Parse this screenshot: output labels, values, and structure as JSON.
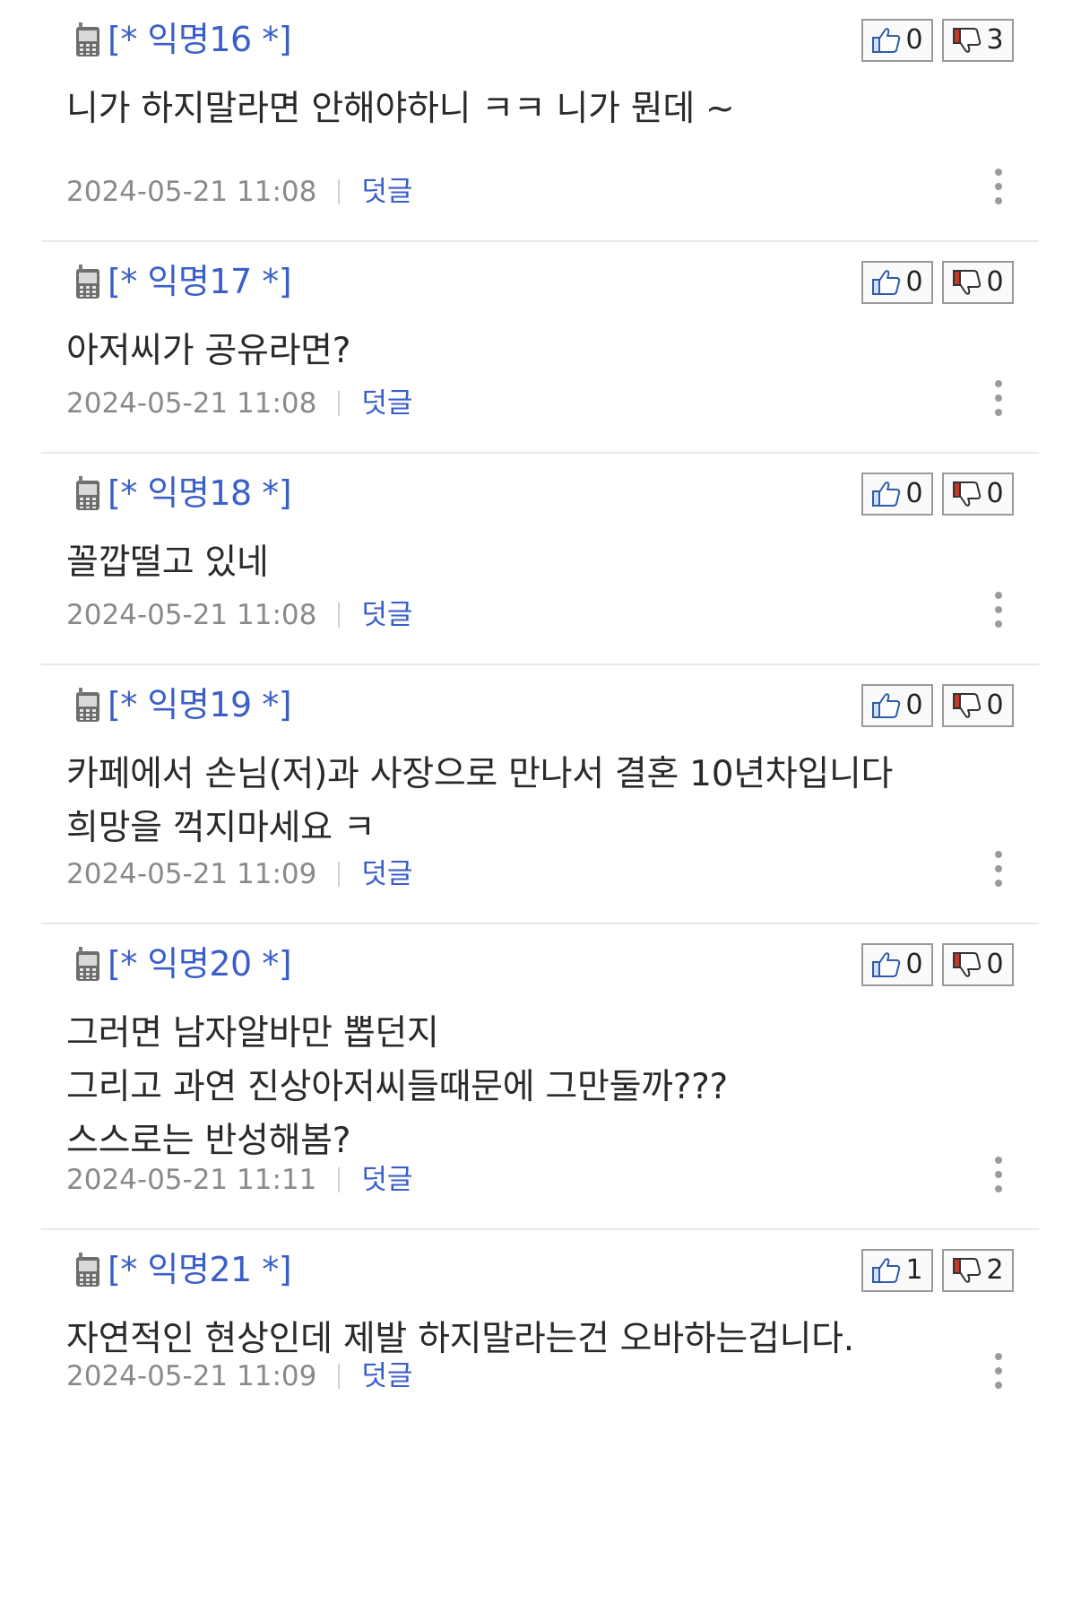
{
  "comments": [
    {
      "author": "[* 익명16 *]",
      "likes": "0",
      "dislikes": "3",
      "lines": [
        "니가 하지말라면 안해야하니 ㅋㅋ 니가 뭔데 ~"
      ],
      "timestamp": "2024-05-21 11:08",
      "reply_label": "덧글"
    },
    {
      "author": "[* 익명17 *]",
      "likes": "0",
      "dislikes": "0",
      "lines": [
        "아저씨가 공유라면?"
      ],
      "timestamp": "2024-05-21 11:08",
      "reply_label": "덧글"
    },
    {
      "author": "[* 익명18 *]",
      "likes": "0",
      "dislikes": "0",
      "lines": [
        "꼴깝떨고 있네"
      ],
      "timestamp": "2024-05-21 11:08",
      "reply_label": "덧글"
    },
    {
      "author": "[* 익명19 *]",
      "likes": "0",
      "dislikes": "0",
      "lines": [
        "카페에서 손님(저)과 사장으로 만나서 결혼 10년차입니다",
        "희망을 꺽지마세요 ㅋ"
      ],
      "timestamp": "2024-05-21 11:09",
      "reply_label": "덧글"
    },
    {
      "author": "[* 익명20 *]",
      "likes": "0",
      "dislikes": "0",
      "lines": [
        "그러면 남자알바만 뽑던지",
        "그리고 과연 진상아저씨들때문에 그만둘까???",
        "스스로는 반성해봄?"
      ],
      "timestamp": "2024-05-21 11:11",
      "reply_label": "덧글"
    },
    {
      "author": "[* 익명21 *]",
      "likes": "1",
      "dislikes": "2",
      "lines": [
        "자연적인 현상인데 제발 하지말라는건 오바하는겁니다."
      ],
      "timestamp": "2024-05-21 11:09",
      "reply_label": "덧글"
    }
  ],
  "icons": {
    "author": "mobile-phone-icon",
    "like": "thumbs-up-icon",
    "dislike": "thumbs-down-icon",
    "more": "more-vertical-icon"
  },
  "colors": {
    "author": "#3a5fc9",
    "reply_link": "#3a5fc9",
    "timestamp": "#8a8a8a",
    "dislike_accent": "#c0392b"
  }
}
